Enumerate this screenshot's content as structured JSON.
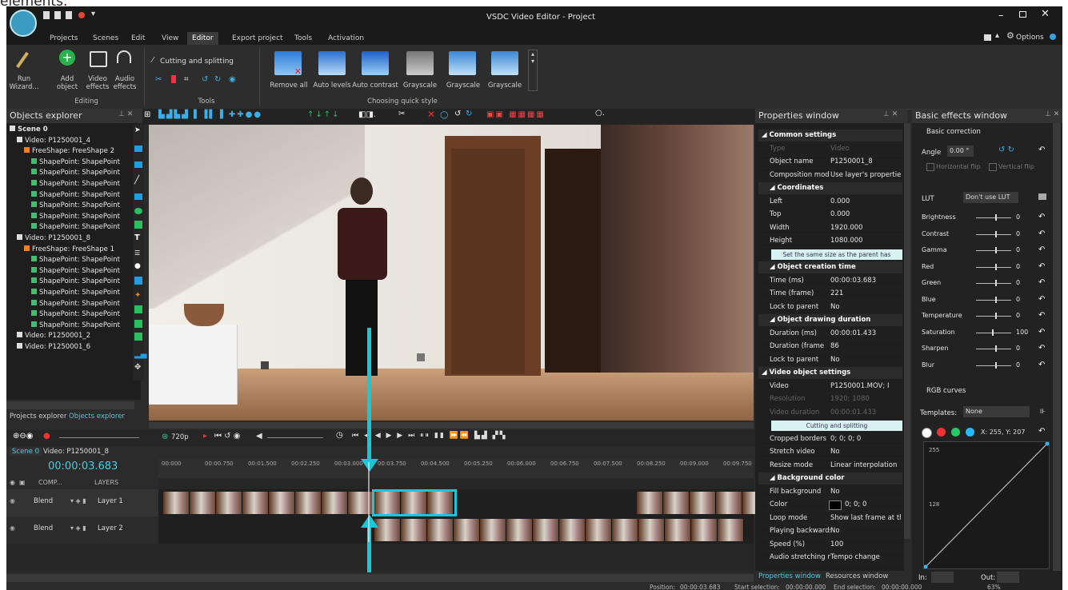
{
  "page_caption": "elements.",
  "window": {
    "title": "VSDC Video Editor - Project",
    "options_label": "Options"
  },
  "menu_tabs": [
    "Projects",
    "Scenes",
    "Edit",
    "View",
    "Editor",
    "Export project",
    "Tools",
    "Activation"
  ],
  "active_tab": "Editor",
  "ribbon": {
    "run_wizard": "Run\nWizard...",
    "add_object": "Add\nobject",
    "video_effects": "Video\neffects",
    "audio_effects": "Audio\neffects",
    "editing_label": "Editing",
    "cutting_splitting": "Cutting and splitting",
    "tools_label": "Tools",
    "quick_styles": [
      "Remove all",
      "Auto levels",
      "Auto contrast",
      "Grayscale",
      "Grayscale",
      "Grayscale"
    ],
    "quick_style_label": "Choosing quick style"
  },
  "objects_explorer": {
    "title": "Objects explorer",
    "tree": [
      {
        "level": 0,
        "label": "Scene 0",
        "icon": "scene-icon"
      },
      {
        "level": 1,
        "label": "Video: P1250001_4",
        "icon": "video-icon"
      },
      {
        "level": 2,
        "label": "FreeShape: FreeShape 2",
        "icon": "shape-icon"
      },
      {
        "level": 3,
        "label": "ShapePoint: ShapePoint",
        "icon": "point-icon"
      },
      {
        "level": 3,
        "label": "ShapePoint: ShapePoint",
        "icon": "point-icon"
      },
      {
        "level": 3,
        "label": "ShapePoint: ShapePoint",
        "icon": "point-icon"
      },
      {
        "level": 3,
        "label": "ShapePoint: ShapePoint",
        "icon": "point-icon"
      },
      {
        "level": 3,
        "label": "ShapePoint: ShapePoint",
        "icon": "point-icon"
      },
      {
        "level": 3,
        "label": "ShapePoint: ShapePoint",
        "icon": "point-icon"
      },
      {
        "level": 3,
        "label": "ShapePoint: ShapePoint",
        "icon": "point-icon"
      },
      {
        "level": 1,
        "label": "Video: P1250001_8",
        "icon": "video-icon"
      },
      {
        "level": 2,
        "label": "FreeShape: FreeShape 1",
        "icon": "shape-icon"
      },
      {
        "level": 3,
        "label": "ShapePoint: ShapePoint",
        "icon": "point-icon"
      },
      {
        "level": 3,
        "label": "ShapePoint: ShapePoint",
        "icon": "point-icon"
      },
      {
        "level": 3,
        "label": "ShapePoint: ShapePoint",
        "icon": "point-icon"
      },
      {
        "level": 3,
        "label": "ShapePoint: ShapePoint",
        "icon": "point-icon"
      },
      {
        "level": 3,
        "label": "ShapePoint: ShapePoint",
        "icon": "point-icon"
      },
      {
        "level": 3,
        "label": "ShapePoint: ShapePoint",
        "icon": "point-icon"
      },
      {
        "level": 3,
        "label": "ShapePoint: ShapePoint",
        "icon": "point-icon"
      },
      {
        "level": 1,
        "label": "Video: P1250001_2",
        "icon": "video-icon"
      },
      {
        "level": 1,
        "label": "Video: P1250001_6",
        "icon": "video-icon"
      }
    ],
    "bottom_tabs": [
      "Projects explorer",
      "Objects explorer"
    ]
  },
  "properties": {
    "title": "Properties window",
    "common_settings": "Common settings",
    "type_label": "Type",
    "type_value": "Video",
    "object_name_label": "Object name",
    "object_name_value": "P1250001_8",
    "composition_label": "Composition mod",
    "composition_value": "Use layer's properties",
    "coordinates": "Coordinates",
    "left_label": "Left",
    "left_value": "0.000",
    "top_label": "Top",
    "top_value": "0.000",
    "width_label": "Width",
    "width_value": "1920.000",
    "height_label": "Height",
    "height_value": "1080.000",
    "same_size_btn": "Set the same size as the parent has",
    "creation_time": "Object creation time",
    "time_ms_label": "Time (ms)",
    "time_ms_value": "00:00:03.683",
    "time_frame_label": "Time (frame)",
    "time_frame_value": "221",
    "lock_parent_label": "Lock to parent",
    "lock_parent_value": "No",
    "drawing_duration": "Object drawing duration",
    "duration_ms_label": "Duration (ms)",
    "duration_ms_value": "00:00:01.433",
    "duration_frame_label": "Duration (frame",
    "duration_frame_value": "86",
    "lock_parent2_label": "Lock to parent",
    "lock_parent2_value": "No",
    "video_settings": "Video object settings",
    "video_label": "Video",
    "video_value": "P1250001.MOV; I",
    "resolution_label": "Resolution",
    "resolution_value": "1920; 1080",
    "video_duration_label": "Video duration",
    "video_duration_value": "00:00:01.433",
    "cutting_btn": "Cutting and splitting",
    "cropped_label": "Cropped borders",
    "cropped_value": "0; 0; 0; 0",
    "stretch_label": "Stretch video",
    "stretch_value": "No",
    "resize_label": "Resize mode",
    "resize_value": "Linear interpolation",
    "bg_color": "Background color",
    "fill_bg_label": "Fill background",
    "fill_bg_value": "No",
    "color_label": "Color",
    "color_value": "0; 0; 0",
    "loop_label": "Loop mode",
    "loop_value": "Show last frame at th",
    "backwards_label": "Playing backwards",
    "backwards_value": "No",
    "speed_label": "Speed (%)",
    "speed_value": "100",
    "audio_stretch_label": "Audio stretching m",
    "audio_stretch_value": "Tempo change",
    "bottom_tabs": [
      "Properties window",
      "Resources window"
    ]
  },
  "effects": {
    "title": "Basic effects window",
    "basic_correction": "Basic correction",
    "angle_label": "Angle",
    "angle_value": "0.00 °",
    "hflip": "Horizontal flip",
    "vflip": "Vertical flip",
    "lut_label": "LUT",
    "lut_value": "Don't use LUT",
    "rows": [
      {
        "label": "Brightness",
        "value": "0"
      },
      {
        "label": "Contrast",
        "value": "0"
      },
      {
        "label": "Gamma",
        "value": "0"
      },
      {
        "label": "Red",
        "value": "0"
      },
      {
        "label": "Green",
        "value": "0"
      },
      {
        "label": "Blue",
        "value": "0"
      },
      {
        "label": "Temperature",
        "value": "0"
      },
      {
        "label": "Saturation",
        "value": "100"
      },
      {
        "label": "Sharpen",
        "value": "0"
      },
      {
        "label": "Blur",
        "value": "0"
      }
    ],
    "rgb_curves": "RGB curves",
    "templates_label": "Templates:",
    "templates_value": "None",
    "xy_readout": "X: 255, Y: 207",
    "curve_top": "255",
    "curve_mid": "128",
    "in_label": "In:",
    "out_label": "Out:"
  },
  "timeline": {
    "scene_tab": "Scene 0",
    "video_tab": "Video: P1250001_8",
    "current_time": "00:00:03.683",
    "resolution": "720p",
    "ruler": [
      "00:000",
      "00:00.750",
      "00:01.500",
      "00:02.250",
      "00:03.000",
      "00:03.750",
      "00:04.500",
      "00:05.250",
      "00:06.000",
      "00:06.750",
      "00:07.500",
      "00:08.250",
      "00:09.000",
      "00:09.750"
    ],
    "header_comp": "COMP...",
    "header_layers": "LAYERS",
    "layers": [
      {
        "blend": "Blend",
        "name": "Layer 1"
      },
      {
        "blend": "Blend",
        "name": "Layer 2"
      }
    ]
  },
  "status": {
    "position": "Position:",
    "position_value": "00:00:03.683",
    "start_sel": "Start selection:",
    "start_sel_value": "00:00:00.000",
    "end_sel": "End selection:",
    "end_sel_value": "00:00:00.000",
    "zoom": "63%"
  },
  "colors": {
    "accent": "#19c8d8",
    "bg": "#2b2b2b"
  }
}
